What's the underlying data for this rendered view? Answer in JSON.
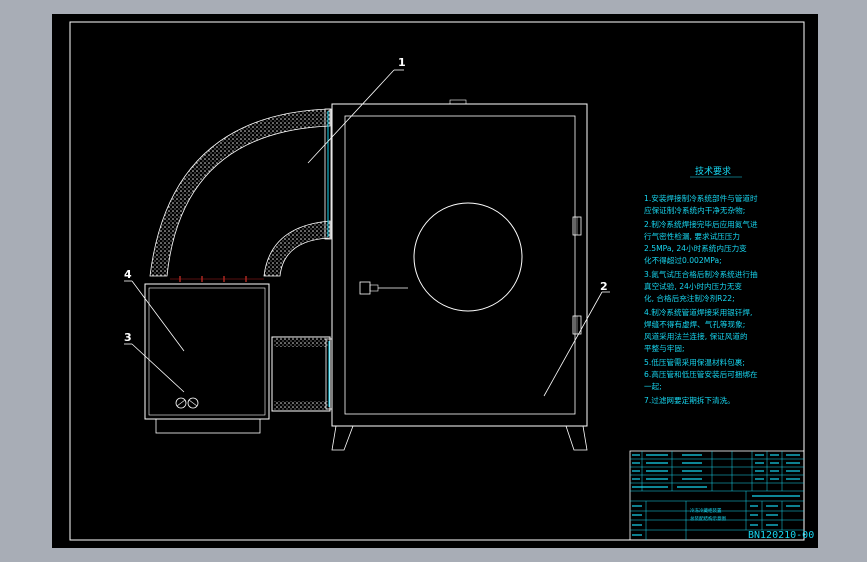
{
  "part_labels": [
    "1",
    "2",
    "3",
    "4"
  ],
  "requirements": {
    "title": "技术要求",
    "lines": [
      "1.安装焊接制冷系统部件与管道时",
      "  应保证制冷系统内干净无杂物;",
      "2.制冷系统焊接完毕后应用氮气进",
      "  行气密性检漏, 要求试压压力",
      "  2.5MPa, 24小时系统内压力变",
      "  化不得超过0.002MPa;",
      "3.氮气试压合格后制冷系统进行抽",
      "  真空试验, 24小时内压力无变",
      "  化, 合格后充注制冷剂R22;",
      "4.制冷系统管道焊接采用银钎焊,",
      "  焊缝不得有虚焊、气孔等现象;",
      "  风道采用法兰连接, 保证风道的",
      "  平整与牢固;",
      "5.低压管需采用保温材料包裹;",
      "6.高压管和低压管安装后可捆绑在",
      "  一起;",
      "7.过滤网要定期拆下清洗。"
    ]
  },
  "title_block": {
    "drawing_title": [
      "冷冻冷藏柜装置",
      "总装配结构示意图"
    ],
    "drawing_number": "BN120210-00"
  },
  "colors": {
    "background": "#000000",
    "frame": "#ffffff",
    "annotation": "#17d6f0",
    "insulation": "#ffffff",
    "connector": "#ff3b30"
  }
}
